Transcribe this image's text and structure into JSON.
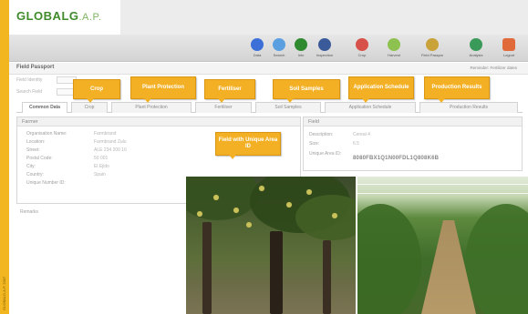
{
  "sidebar": {
    "text": "GLOBALG.A.P. 2007"
  },
  "logo": {
    "brand": "GLOBALG",
    "suffix": ".A.P."
  },
  "toolbar": {
    "tools": [
      {
        "label": "Data",
        "icon": "globe-icon",
        "color": "#3c6fd8"
      },
      {
        "label": "Search",
        "icon": "search-icon",
        "color": "#5aa0e0"
      },
      {
        "label": "Info",
        "icon": "plant-icon",
        "color": "#2f8a2f"
      },
      {
        "label": "Inspection",
        "icon": "people-icon",
        "color": "#3a5a9a"
      },
      {
        "label": "Crop",
        "icon": "fruit-icon",
        "color": "#d8504a"
      },
      {
        "label": "Harvest",
        "icon": "leaf-icon",
        "color": "#8ec250"
      },
      {
        "label": "Field Passport",
        "icon": "tool-icon",
        "color": "#c9a23a"
      },
      {
        "label": "Analysis",
        "icon": "plant-bulb-icon",
        "color": "#3a9a5a"
      },
      {
        "label": "Logout",
        "icon": "logout-icon",
        "color": "#e06a3a"
      }
    ]
  },
  "page": {
    "title": "Field Passport",
    "reminder": "Reminder: Fertilizer dates",
    "filter_row1_label": "Field Identity",
    "filter_row2_label": "Search Field"
  },
  "tabs": [
    {
      "label": "Common Data",
      "active": true
    },
    {
      "label": "Crop",
      "active": false
    },
    {
      "label": "Plant Protection",
      "active": false
    },
    {
      "label": "Fertiliser",
      "active": false
    },
    {
      "label": "Soil Samples",
      "active": false
    },
    {
      "label": "Application Schedule",
      "active": false
    },
    {
      "label": "Production Results",
      "active": false
    }
  ],
  "farmer_panel": {
    "title": "Farmer",
    "rows": [
      {
        "key": "Organisation Name:",
        "value": "Farmbrand"
      },
      {
        "key": "Location:",
        "value": "Farmbrand Zulu"
      },
      {
        "key": "Street:",
        "value": "ALE 234 200 16"
      },
      {
        "key": "Postal Code:",
        "value": "50 001"
      },
      {
        "key": "City:",
        "value": "El Ejido"
      },
      {
        "key": "Country:",
        "value": "Spain"
      },
      {
        "key": "Unique Number ID:",
        "value": ""
      }
    ],
    "footer": "Remarks"
  },
  "field_panel": {
    "title": "Field",
    "rows": [
      {
        "key": "Description:",
        "value": "Cereal 4"
      },
      {
        "key": "Size:",
        "value": "6.5"
      },
      {
        "key": "Unique Area ID:",
        "value": "8080FBX1Q1N00FDL1Q808K6B"
      }
    ]
  },
  "callouts": {
    "crop": "Crop",
    "plant_protection": "Plant Protection",
    "fertiliser": "Fertiliser",
    "soil_samples": "Soil Samples",
    "application_schedule": "Application Schedule",
    "production_results": "Production Results",
    "field_unique": "Field with Unique Area ID"
  },
  "colors": {
    "sidebar": "#f2b620",
    "callout": "#f3b024",
    "logo_green": "#3f8a2a"
  }
}
